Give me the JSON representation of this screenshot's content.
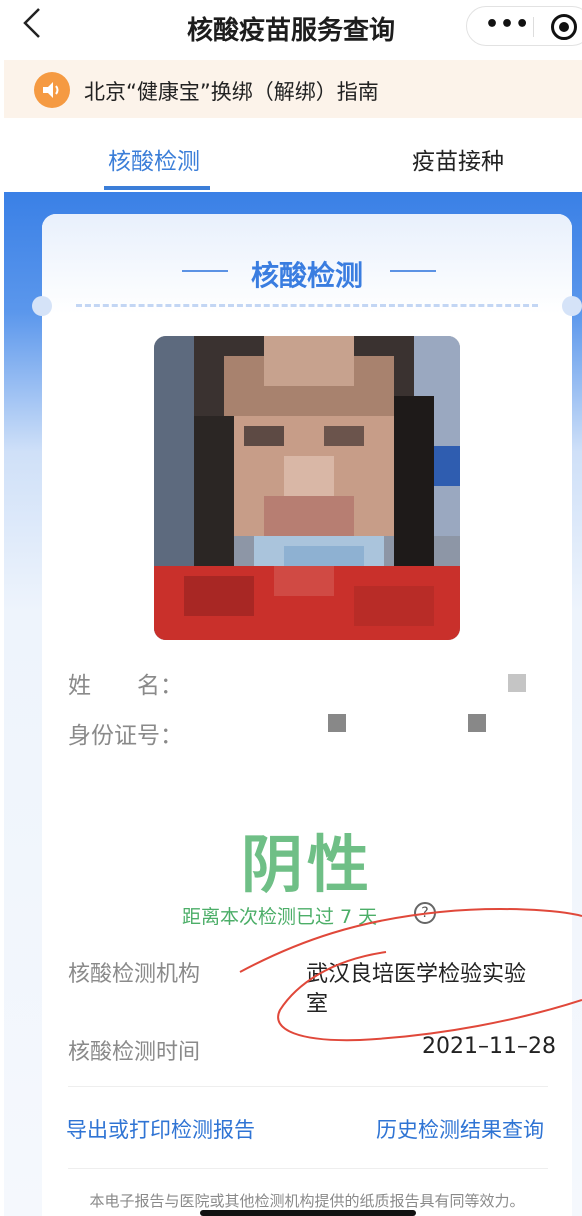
{
  "header": {
    "back_icon": "chevron-left-icon",
    "title": "核酸疫苗服务查询",
    "more_icon": "more-dots-icon",
    "close_icon": "target-close-icon"
  },
  "notice": {
    "icon": "speaker-icon",
    "text": "北京“健康宝”换绑（解绑）指南",
    "icon_color": "#f59a42"
  },
  "tabs": [
    {
      "label": "核酸检测",
      "active": true
    },
    {
      "label": "疫苗接种",
      "active": false
    }
  ],
  "card": {
    "title": "核酸检测",
    "name_label": "姓　　名：",
    "id_label": "身份证号：",
    "result": "阴性",
    "since_text": "距离本次检测已过 7 天",
    "help_icon": "question-circle-icon",
    "institution_label": "核酸检测机构",
    "institution_value_line1": "武汉良培医学检验实验",
    "institution_value_line2": "室",
    "time_label": "核酸检测时间",
    "time_value": "2021–11–28",
    "export_link": "导出或打印检测报告",
    "history_link": "历史检测结果查询",
    "disclaimer": "本电子报告与医院或其他检测机构提供的纸质报告具有同等效力。"
  },
  "colors": {
    "accent_blue": "#3b7ed8",
    "result_green": "#6fbf86",
    "scribble_red": "#e0483a"
  }
}
